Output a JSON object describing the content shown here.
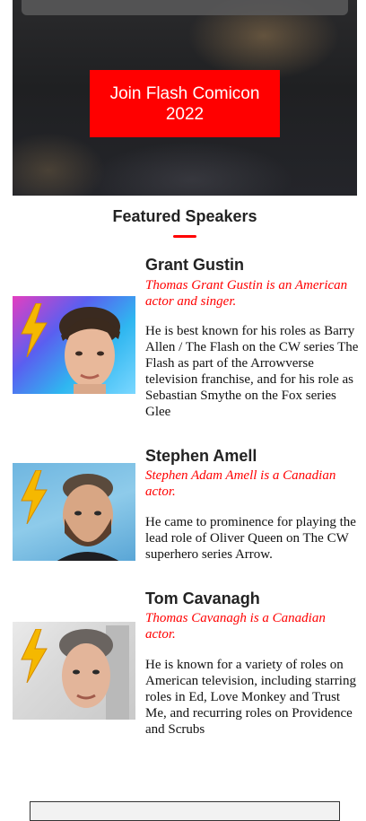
{
  "hero": {
    "cta_label": "Join Flash Comicon 2022"
  },
  "featured": {
    "title": "Featured Speakers",
    "accent_color": "#ff0000"
  },
  "speakers": [
    {
      "name": "Grant Gustin",
      "tagline": "Thomas Grant Gustin is an American actor and singer.",
      "bio": "He is best known for his roles as Barry Allen / The Flash on the CW series The Flash as part of the Arrowverse television franchise, and for his role as Sebastian Smythe on the Fox series Glee",
      "photo_icon": "lightning-bolt-icon"
    },
    {
      "name": "Stephen Amell",
      "tagline": "Stephen Adam Amell is a Canadian actor.",
      "bio": "He came to prominence for playing the lead role of Oliver Queen on The CW superhero series Arrow.",
      "photo_icon": "lightning-bolt-icon"
    },
    {
      "name": "Tom Cavanagh",
      "tagline": "Thomas Cavanagh is a Canadian actor.",
      "bio": "He is known for a variety of roles on American television, including starring roles in Ed, Love Monkey and Trust Me, and recurring roles on Providence and Scrubs",
      "photo_icon": "lightning-bolt-icon"
    }
  ]
}
